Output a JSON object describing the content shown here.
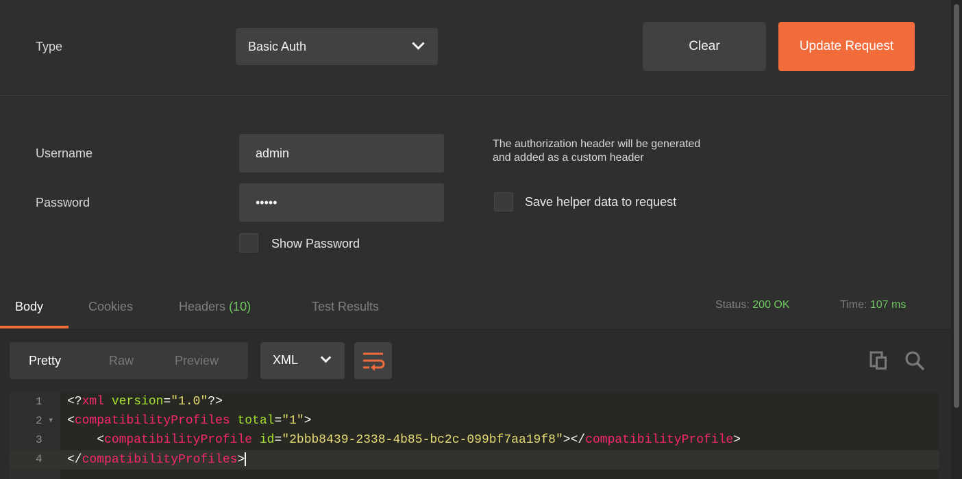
{
  "auth": {
    "type_label": "Type",
    "type_value": "Basic Auth",
    "clear_label": "Clear",
    "update_label": "Update Request"
  },
  "credentials": {
    "username_label": "Username",
    "username_value": "admin",
    "password_label": "Password",
    "password_value": "•••••",
    "show_password_label": "Show Password",
    "hint_line1": "The authorization header will be generated",
    "hint_line2": "and added as a custom header",
    "save_helper_label": "Save helper data to request"
  },
  "response": {
    "tabs": {
      "body": "Body",
      "cookies": "Cookies",
      "headers": "Headers",
      "headers_count": "(10)",
      "tests": "Test Results"
    },
    "status_label": "Status:",
    "status_value": "200 OK",
    "time_label": "Time:",
    "time_value": "107 ms"
  },
  "toolbar": {
    "pretty": "Pretty",
    "raw": "Raw",
    "preview": "Preview",
    "format": "XML"
  },
  "editor": {
    "line_numbers": [
      "1",
      "2",
      "3",
      "4"
    ],
    "line1": {
      "open": "<?",
      "tag": "xml",
      "attr": " version",
      "eq": "=",
      "val": "\"1.0\"",
      "close": "?>"
    },
    "line2": {
      "open": "<",
      "tag": "compatibilityProfiles",
      "attr": " total",
      "eq": "=",
      "val": "\"1\"",
      "close": ">"
    },
    "line3": {
      "indent": "    ",
      "open": "<",
      "tag": "compatibilityProfile",
      "attr": " id",
      "eq": "=",
      "val": "\"2bbb8439-2338-4b85-bc2c-099bf7aa19f8\"",
      "mid": "></",
      "tag2": "compatibilityProfile",
      "close": ">"
    },
    "line4": {
      "open": "</",
      "tag": "compatibilityProfiles",
      "close": ">"
    }
  },
  "colors": {
    "accent": "#f26b3a",
    "status_ok": "#6fc85f",
    "xml_tag": "#f92672",
    "xml_attr": "#a6e22e",
    "xml_string": "#e6db74"
  },
  "icons": [
    "chevron-down-icon",
    "wrap-lines-icon",
    "copy-icon",
    "search-icon"
  ]
}
